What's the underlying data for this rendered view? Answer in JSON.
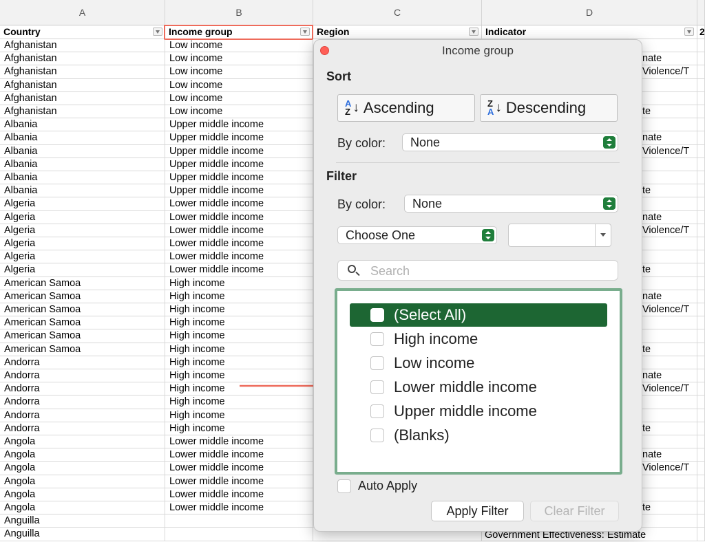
{
  "sheet": {
    "columns": [
      "A",
      "B",
      "C",
      "D"
    ],
    "headers": {
      "country": "Country",
      "income_group": "Income group",
      "region": "Region",
      "indicator": "Indicator",
      "next": "2"
    },
    "rows": [
      [
        "Afghanistan",
        "Low income",
        ""
      ],
      [
        "Afghanistan",
        "Low income",
        "nate"
      ],
      [
        "Afghanistan",
        "Low income",
        "Violence/T"
      ],
      [
        "Afghanistan",
        "Low income",
        ""
      ],
      [
        "Afghanistan",
        "Low income",
        ""
      ],
      [
        "Afghanistan",
        "Low income",
        "te"
      ],
      [
        "Albania",
        "Upper middle income",
        ""
      ],
      [
        "Albania",
        "Upper middle income",
        "nate"
      ],
      [
        "Albania",
        "Upper middle income",
        "Violence/T"
      ],
      [
        "Albania",
        "Upper middle income",
        ""
      ],
      [
        "Albania",
        "Upper middle income",
        ""
      ],
      [
        "Albania",
        "Upper middle income",
        "te"
      ],
      [
        "Algeria",
        "Lower middle income",
        ""
      ],
      [
        "Algeria",
        "Lower middle income",
        "nate"
      ],
      [
        "Algeria",
        "Lower middle income",
        "Violence/T"
      ],
      [
        "Algeria",
        "Lower middle income",
        ""
      ],
      [
        "Algeria",
        "Lower middle income",
        ""
      ],
      [
        "Algeria",
        "Lower middle income",
        "te"
      ],
      [
        "American Samoa",
        "High income",
        ""
      ],
      [
        "American Samoa",
        "High income",
        "nate"
      ],
      [
        "American Samoa",
        "High income",
        "Violence/T"
      ],
      [
        "American Samoa",
        "High income",
        ""
      ],
      [
        "American Samoa",
        "High income",
        ""
      ],
      [
        "American Samoa",
        "High income",
        "te"
      ],
      [
        "Andorra",
        "High income",
        ""
      ],
      [
        "Andorra",
        "High income",
        "nate"
      ],
      [
        "Andorra",
        "High income",
        "Violence/T"
      ],
      [
        "Andorra",
        "High income",
        ""
      ],
      [
        "Andorra",
        "High income",
        ""
      ],
      [
        "Andorra",
        "High income",
        "te"
      ],
      [
        "Angola",
        "Lower middle income",
        ""
      ],
      [
        "Angola",
        "Lower middle income",
        "nate"
      ],
      [
        "Angola",
        "Lower middle income",
        "Violence/T"
      ],
      [
        "Angola",
        "Lower middle income",
        ""
      ],
      [
        "Angola",
        "Lower middle income",
        ""
      ],
      [
        "Angola",
        "Lower middle income",
        "te"
      ],
      [
        "Anguilla",
        "",
        ""
      ],
      [
        "Anguilla",
        "",
        ""
      ]
    ],
    "last_indicator": "Government Effectiveness: Estimate"
  },
  "popover": {
    "title": "Income group",
    "sort_heading": "Sort",
    "ascending_label": "Ascending",
    "descending_label": "Descending",
    "by_color_label": "By color:",
    "sort_color_value": "None",
    "filter_heading": "Filter",
    "filter_color_value": "None",
    "choose_value": "Choose One",
    "search_placeholder": "Search",
    "items": [
      "(Select All)",
      "High income",
      "Low income",
      "Lower middle income",
      "Upper middle income",
      "(Blanks)"
    ],
    "auto_apply_label": "Auto Apply",
    "apply_label": "Apply Filter",
    "clear_label": "Clear Filter"
  },
  "colors": {
    "selected_item": "#1d6633",
    "list_border": "#79ad8d",
    "highlight": "#ee6b5b",
    "stepper": "#1f7e3b"
  }
}
